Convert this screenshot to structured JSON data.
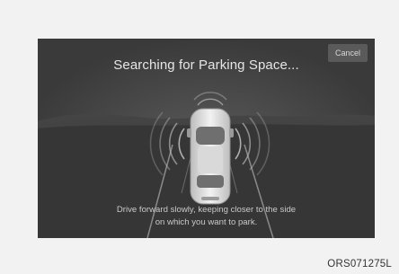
{
  "screen": {
    "title": "Searching for Parking Space...",
    "cancel_label": "Cancel",
    "instruction_line1": "Drive forward slowly, keeping closer to the side",
    "instruction_line2": "on which you want to park."
  },
  "figure_code": "ORS071275L",
  "colors": {
    "screen_background": "#3a3a3a",
    "page_background": "#f2f2f2",
    "text": "#e6e6e6"
  }
}
